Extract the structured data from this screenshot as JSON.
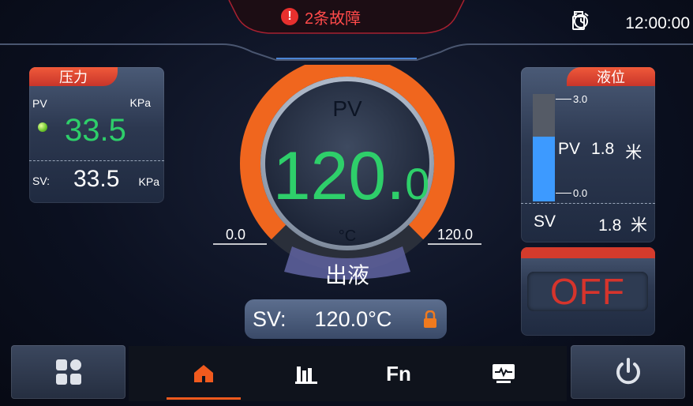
{
  "header": {
    "alarm_text": "2条故障",
    "alarm_icon": "exclamation-icon",
    "time": "12:00:00",
    "colors": {
      "alarm": "#ff4a4a"
    }
  },
  "pressure": {
    "title": "压力",
    "pv_label": "PV",
    "unit": "KPa",
    "pv_value": "33.5",
    "sv_label": "SV:",
    "sv_value": "33.5",
    "sv_unit": "KPa"
  },
  "gauge": {
    "pv_label": "PV",
    "value_int": "120.",
    "value_dec": "0",
    "unit": "°C",
    "mode": "出液",
    "min": "0.0",
    "max": "120.0",
    "level": 1.0,
    "colors": {
      "arc": "#f0661e",
      "value": "#2ecf6a"
    }
  },
  "setpoint": {
    "label": "SV:",
    "value": "120.0°C",
    "locked": true
  },
  "level": {
    "title": "液位",
    "max": "3.0",
    "min": "0.0",
    "pv_label": "PV",
    "pv_value": "1.8",
    "pv_unit": "米",
    "sv_label": "SV",
    "sv_value": "1.8",
    "sv_unit": "米",
    "fill_fraction": 0.6,
    "colors": {
      "fill": "#3d9aff"
    }
  },
  "power_state": {
    "label": "OFF",
    "color": "#d6342c"
  },
  "nav": {
    "fn_label": "Fn",
    "active_tab": "home",
    "colors": {
      "active": "#f05a1e"
    }
  }
}
